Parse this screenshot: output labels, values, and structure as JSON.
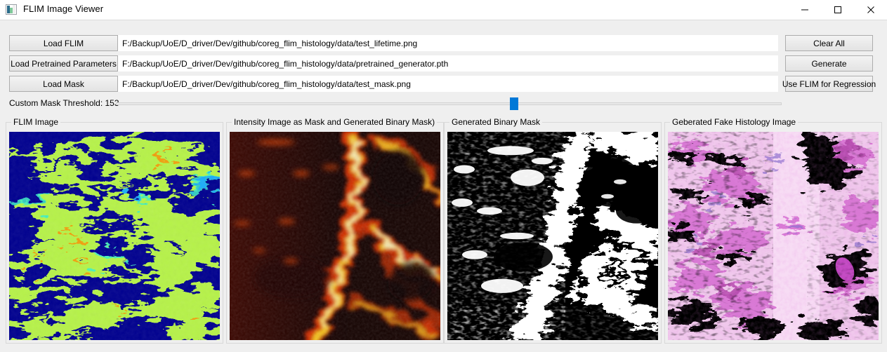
{
  "window": {
    "title": "FLIM Image Viewer",
    "icon": "image-chart-icon",
    "controls": {
      "minimize": "minimize-icon",
      "maximize": "maximize-icon",
      "close": "close-icon"
    }
  },
  "toolbar": {
    "rows": [
      {
        "button": "Load FLIM",
        "path": "F:/Backup/UoE/D_driver/Dev/github/coreg_flim_histology/data/test_lifetime.png",
        "action": "Clear All"
      },
      {
        "button": "Load Pretrained Parameters",
        "path": "F:/Backup/UoE/D_driver/Dev/github/coreg_flim_histology/data/pretrained_generator.pth",
        "action": "Generate"
      },
      {
        "button": "Load Mask",
        "path": "F:/Backup/UoE/D_driver/Dev/github/coreg_flim_histology/data/test_mask.png",
        "action": "Use FLIM for Regression"
      }
    ]
  },
  "slider": {
    "label": "Custom Mask Threshold: 153",
    "value": 153,
    "min": 0,
    "max": 255,
    "handle_color": "#0078d7"
  },
  "panels": [
    {
      "legend": "FLIM Image",
      "content": "flim-lifetime-jet-colormap-image"
    },
    {
      "legend": "Intensity Image as Mask and Generated Binary Mask)",
      "content": "intensity-hot-colormap-image"
    },
    {
      "legend": "Generated Binary Mask",
      "content": "binary-black-white-mask-image"
    },
    {
      "legend": "Geberated Fake Histology Image",
      "content": "fake-histology-he-stain-image"
    }
  ],
  "colors": {
    "accent": "#0078d7",
    "window_bg": "#efefef",
    "titlebar_bg": "#ffffff",
    "button_border": "#adadad",
    "group_border": "#d8d8d8"
  }
}
